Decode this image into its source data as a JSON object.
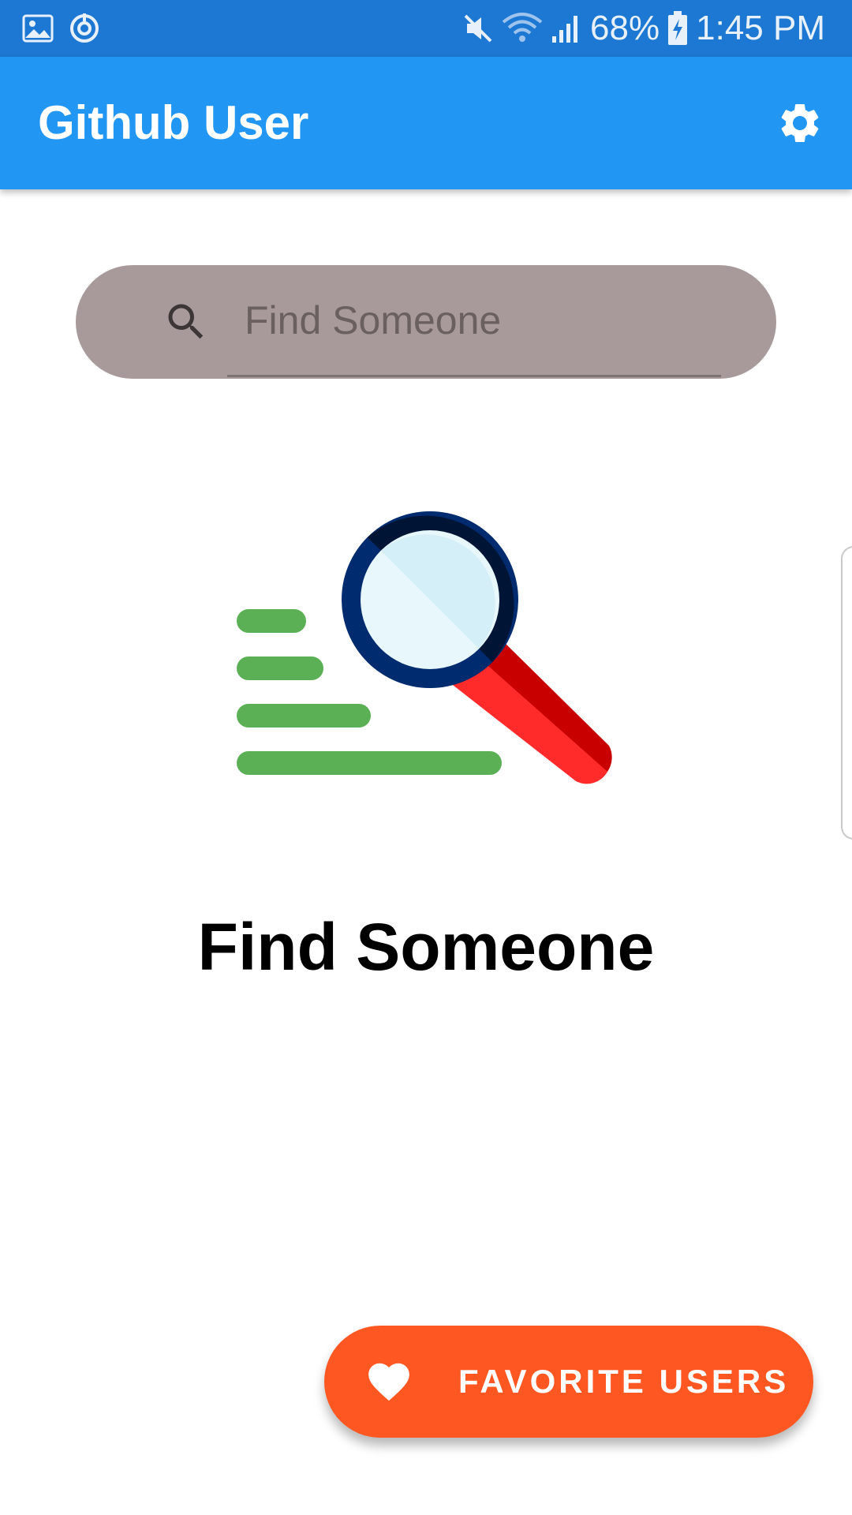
{
  "status_bar": {
    "battery": "68%",
    "time": "1:45 PM",
    "icons": [
      "gallery-icon",
      "sync-icon",
      "mute-icon",
      "wifi-icon",
      "signal-icon",
      "battery-charging-icon"
    ]
  },
  "app_bar": {
    "title": "Github User",
    "settings_icon": "gear-icon",
    "color": "#2196F3"
  },
  "search": {
    "placeholder": "Find Someone",
    "value": "",
    "icon": "search-icon",
    "background": "#A89A9A"
  },
  "empty_state": {
    "illustration": "magnifier-illustration",
    "title": "Find Someone"
  },
  "fab": {
    "label": "FAVORITE USERS",
    "icon": "heart-icon",
    "color": "#FF5722"
  }
}
